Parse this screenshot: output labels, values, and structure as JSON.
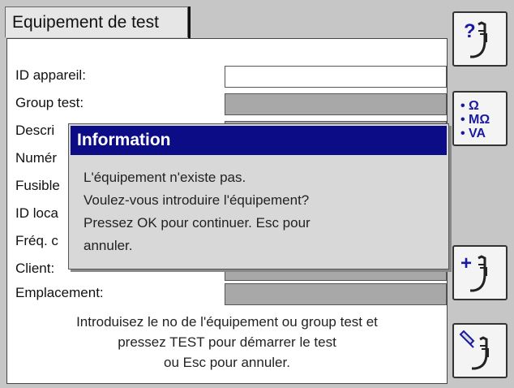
{
  "tab": {
    "title": "Equipement de test"
  },
  "form": {
    "fields": [
      {
        "label": "ID appareil:"
      },
      {
        "label": "Group test:"
      },
      {
        "label": "Descri"
      },
      {
        "label": "Numér"
      },
      {
        "label": "Fusible"
      },
      {
        "label": "ID loca"
      },
      {
        "label": "Fréq. c"
      },
      {
        "label": "Client:"
      },
      {
        "label": "Emplacement:"
      }
    ]
  },
  "hint": {
    "line1": "Introduisez le no de l'équipement ou group test et",
    "line2": "pressez TEST pour démarrer le test",
    "line3": "ou Esc pour annuler."
  },
  "dialog": {
    "title": "Information",
    "line1": "L'équipement n'existe pas.",
    "line2": "Voulez-vous introduire l'équipement?",
    "line3": "Pressez OK pour continuer. Esc pour",
    "line4": "annuler."
  },
  "side_buttons": {
    "help": {
      "glyph": "?",
      "icon": "help-probe-icon"
    },
    "units": {
      "line1": "• Ω",
      "line2": "• MΩ",
      "line3": "• VA",
      "icon": "units-icon"
    },
    "add": {
      "glyph": "+",
      "icon": "add-probe-icon"
    },
    "edit": {
      "icon": "edit-probe-icon"
    }
  },
  "colors": {
    "title_bar": "#0c0c86",
    "field_gray": "#a8a8a8",
    "accent_blue": "#1a1aa0"
  }
}
